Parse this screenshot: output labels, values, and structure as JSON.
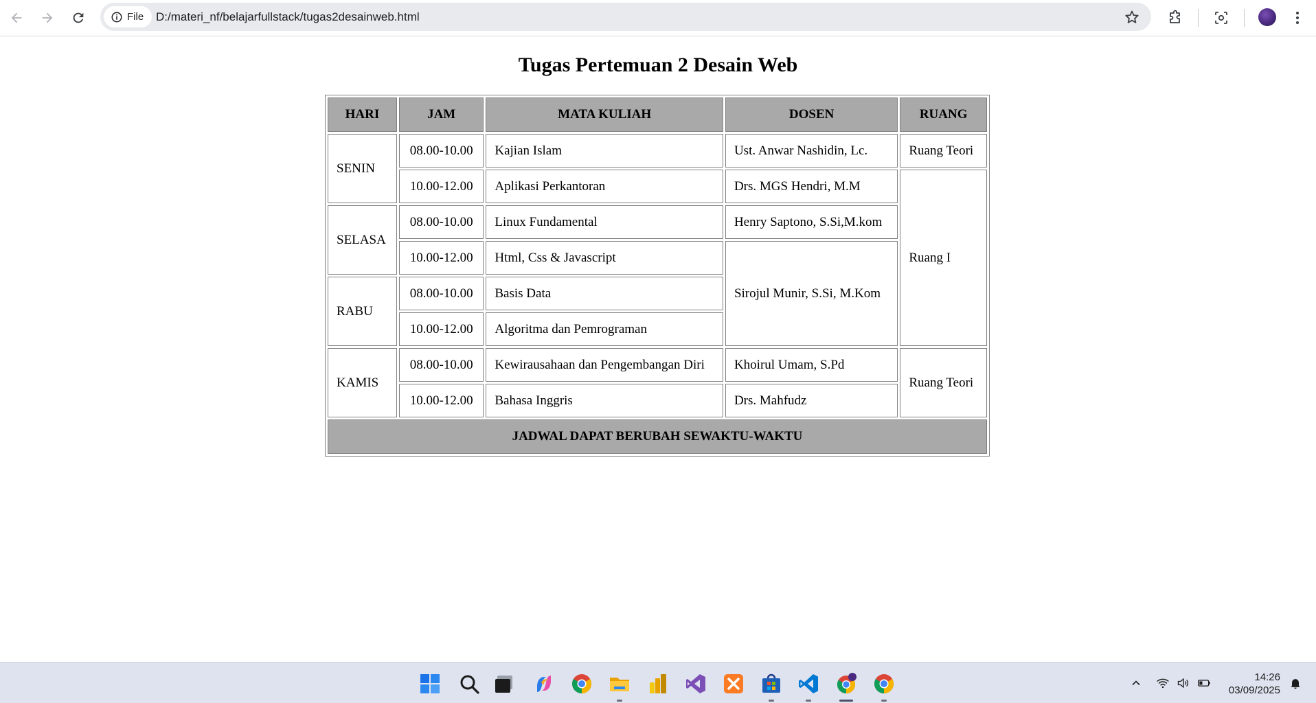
{
  "browser": {
    "site_chip_label": "File",
    "url": "D:/materi_nf/belajarfullstack/tugas2desainweb.html"
  },
  "page": {
    "title": "Tugas Pertemuan 2 Desain Web",
    "table": {
      "headers": [
        "HARI",
        "JAM",
        "MATA KULIAH",
        "DOSEN",
        "RUANG"
      ],
      "rows": [
        {
          "hari": "SENIN",
          "jam": "08.00-10.00",
          "mata_kuliah": "Kajian Islam",
          "dosen": "Ust. Anwar Nashidin, Lc.",
          "ruang": "Ruang Teori"
        },
        {
          "hari": "",
          "jam": "10.00-12.00",
          "mata_kuliah": "Aplikasi Perkantoran",
          "dosen": "Drs. MGS Hendri, M.M",
          "ruang": "Ruang I"
        },
        {
          "hari": "SELASA",
          "jam": "08.00-10.00",
          "mata_kuliah": "Linux Fundamental",
          "dosen": "Henry Saptono, S.Si,M.kom",
          "ruang": ""
        },
        {
          "hari": "",
          "jam": "10.00-12.00",
          "mata_kuliah": "Html, Css & Javascript",
          "dosen": "Sirojul Munir, S.Si, M.Kom",
          "ruang": ""
        },
        {
          "hari": "RABU",
          "jam": "08.00-10.00",
          "mata_kuliah": "Basis Data",
          "dosen": "",
          "ruang": ""
        },
        {
          "hari": "",
          "jam": "10.00-12.00",
          "mata_kuliah": "Algoritma dan Pemrograman",
          "dosen": "",
          "ruang": ""
        },
        {
          "hari": "KAMIS",
          "jam": "08.00-10.00",
          "mata_kuliah": "Kewirausahaan dan Pengembangan Diri",
          "dosen": "Khoirul Umam, S.Pd",
          "ruang": "Ruang Teori"
        },
        {
          "hari": "",
          "jam": "10.00-12.00",
          "mata_kuliah": "Bahasa Inggris",
          "dosen": "Drs. Mahfudz",
          "ruang": ""
        }
      ],
      "footer": "JADWAL DAPAT BERUBAH SEWAKTU-WAKTU"
    }
  },
  "taskbar": {
    "icons": [
      "windows-start-icon",
      "search-icon",
      "task-view-icon",
      "copilot-icon",
      "chrome-icon",
      "file-explorer-icon",
      "power-bi-icon",
      "visual-studio-icon",
      "xampp-icon",
      "microsoft-store-icon",
      "vscode-icon",
      "chrome-profile-icon",
      "chrome-icon"
    ],
    "time": "14:26",
    "date": "03/09/2025"
  }
}
